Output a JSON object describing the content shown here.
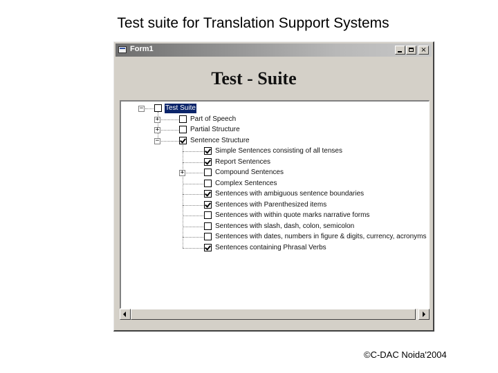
{
  "slide": {
    "title": "Test suite for Translation Support Systems",
    "footer": "©C-DAC Noida'2004"
  },
  "window": {
    "title": "Form1",
    "heading": "Test - Suite",
    "controls": {
      "minimize": "",
      "maximize": "",
      "close": "×"
    }
  },
  "tree": {
    "root": {
      "label": "Test Suite",
      "checked": false,
      "expanded": true,
      "selected": true
    },
    "level1": [
      {
        "label": "Part of Speech",
        "checked": false,
        "expander": "+"
      },
      {
        "label": "Partial Structure",
        "checked": false,
        "expander": "+"
      },
      {
        "label": "Sentence Structure",
        "checked": true,
        "expander": "−"
      }
    ],
    "sentence_items": [
      {
        "label": "Simple Sentences consisting  of all tenses",
        "checked": true,
        "expander": ""
      },
      {
        "label": "Report Sentences",
        "checked": true,
        "expander": ""
      },
      {
        "label": "Compound Sentences",
        "checked": false,
        "expander": "+"
      },
      {
        "label": "Complex Sentences",
        "checked": false,
        "expander": ""
      },
      {
        "label": "Sentences with ambiguous sentence boundaries",
        "checked": true,
        "expander": ""
      },
      {
        "label": "Sentences with Parenthesized items",
        "checked": true,
        "expander": ""
      },
      {
        "label": "Sentences with within quote marks narrative forms",
        "checked": false,
        "expander": ""
      },
      {
        "label": "Sentences with slash, dash, colon, semicolon",
        "checked": false,
        "expander": ""
      },
      {
        "label": "Sentences with dates, numbers in figure & digits, currency, acronyms",
        "checked": false,
        "expander": ""
      },
      {
        "label": "Sentences containing  Phrasal Verbs",
        "checked": true,
        "expander": ""
      }
    ]
  }
}
